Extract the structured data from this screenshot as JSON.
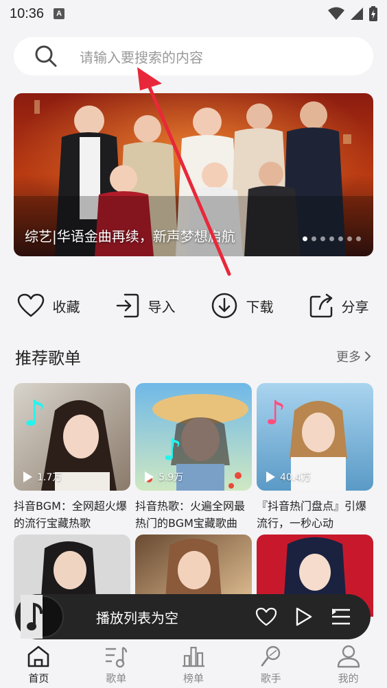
{
  "status": {
    "time": "10:36",
    "badge": "A"
  },
  "search": {
    "placeholder": "请输入要搜索的内容"
  },
  "banner": {
    "caption": "综艺|华语金曲再续，新声梦想启航",
    "dot_count": 7,
    "active_dot": 0
  },
  "quick_actions": [
    {
      "label": "收藏",
      "icon": "heart-icon"
    },
    {
      "label": "导入",
      "icon": "import-icon"
    },
    {
      "label": "下载",
      "icon": "download-icon"
    },
    {
      "label": "分享",
      "icon": "share-icon"
    }
  ],
  "section": {
    "title": "推荐歌单",
    "more": "更多"
  },
  "playlists": [
    {
      "title": "抖音BGM：全网超火爆的流行宝藏热歌",
      "plays": "1.7万"
    },
    {
      "title": "抖音热歌：火遍全网最热门的BGM宝藏歌曲",
      "plays": "5.9万"
    },
    {
      "title": "『抖音热门盘点』引爆流行，一秒心动",
      "plays": "40.4万"
    }
  ],
  "player": {
    "text": "播放列表为空"
  },
  "tabs": [
    {
      "label": "首页",
      "icon": "home-icon",
      "active": true
    },
    {
      "label": "歌单",
      "icon": "playlist-icon",
      "active": false
    },
    {
      "label": "榜单",
      "icon": "chart-icon",
      "active": false
    },
    {
      "label": "歌手",
      "icon": "singer-icon",
      "active": false
    },
    {
      "label": "我的",
      "icon": "user-icon",
      "active": false
    }
  ],
  "colors": {
    "background": "#f4f4f6",
    "player_bg": "#252526",
    "annotation_arrow": "#e8283a"
  }
}
